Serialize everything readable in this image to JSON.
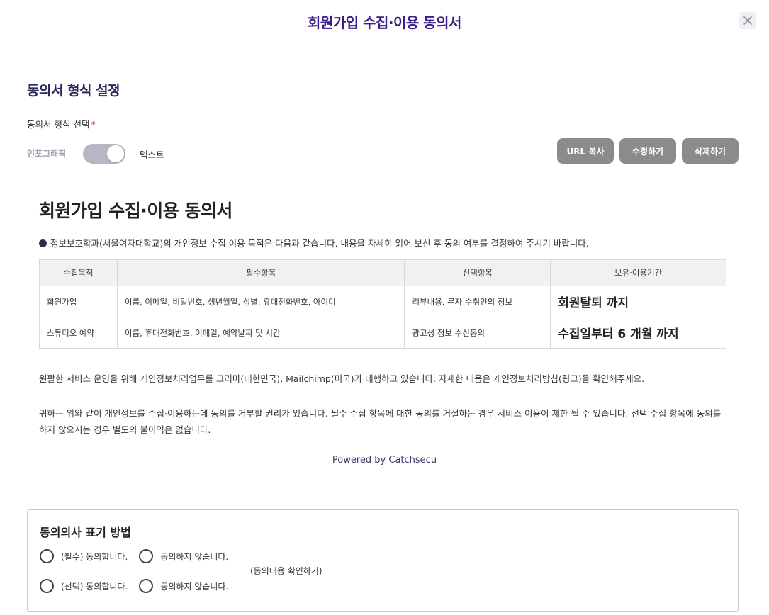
{
  "header": {
    "title": "회원가입 수집·이용 동의서"
  },
  "settings": {
    "section_title": "동의서 형식 설정",
    "field_label": "동의서 형식 선택",
    "required_mark": "*",
    "toggle_left": "인포그래픽",
    "toggle_right": "텍스트",
    "buttons": {
      "url_copy": "URL 복사",
      "edit": "수정하기",
      "delete": "삭제하기"
    }
  },
  "document": {
    "title": "회원가입 수집·이용 동의서",
    "intro": "정보보호학과(서울여자대학교)의 개인정보 수집 이용 목적은 다음과 같습니다. 내용을 자세히 읽어 보신 후 동의 여부를 결정하여 주시기 바랍니다.",
    "table": {
      "headers": [
        "수집목적",
        "필수항목",
        "선택항목",
        "보유·이용기간"
      ],
      "rows": [
        [
          "회원가입",
          "이름, 이메일, 비밀번호, 생년월일, 성별, 휴대전화번호, 아이디",
          "리뷰내용, 문자 수취인의 정보",
          "회원탈퇴 까지"
        ],
        [
          "스튜디오 예약",
          "이름, 휴대전화번호, 이메일, 예약날짜 및 시간",
          "광고성 정보 수신동의",
          "수집일부터 6 개월 까지"
        ]
      ]
    },
    "para1": "원활한 서비스 운영을 위해 개인정보처리업무를 크리마(대한민국), Mailchimp(미국)가 대행하고 있습니다. 자세한 내용은 개인정보처리방침(링크)을 확인해주세요.",
    "para2": "귀하는 위와 같이 개인정보를 수집·이용하는데 동의를 거부할 권리가 있습니다. 필수 수집 항목에 대한 동의를 거절하는 경우 서비스 이용이 제한 될 수 있습니다. 선택 수집 항목에 동의를 하지 않으시는 경우 별도의 불이익은 없습니다.",
    "powered": "Powered by Catchsecu"
  },
  "consent_method": {
    "title": "동의의사 표기 방법",
    "required_agree": "(필수) 동의합니다.",
    "required_disagree": "동의하지 않습니다.",
    "optional_agree": "(선택) 동의합니다.",
    "optional_disagree": "동의하지 않습니다.",
    "note": "(동의내용 확인하기)"
  },
  "icons": {
    "close": "close-icon",
    "bullet": "bullet-icon"
  },
  "colors": {
    "title_accent": "#3b1e8a",
    "button_gray": "#8b8b8e",
    "toggle_track": "#b6b6c4"
  }
}
